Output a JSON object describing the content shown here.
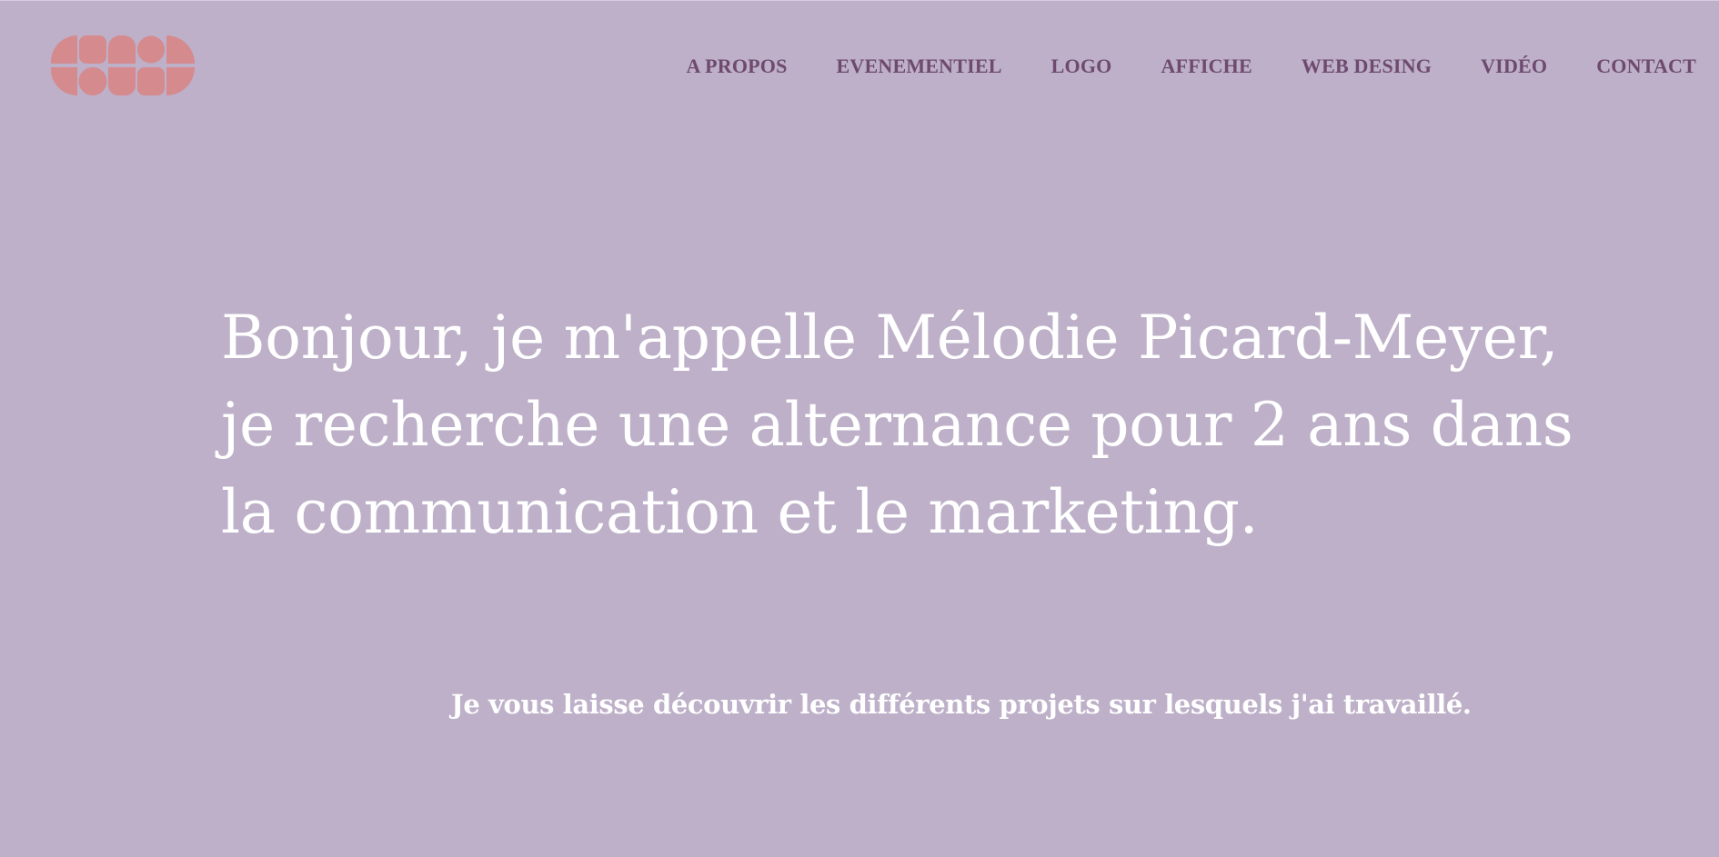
{
  "header": {
    "logo": "logo-mark-icon",
    "logo_color": "#d58a8e",
    "nav": [
      {
        "label": "A PROPOS"
      },
      {
        "label": "EVENEMENTIEL"
      },
      {
        "label": "LOGO"
      },
      {
        "label": "AFFICHE"
      },
      {
        "label": "WEB DESING"
      },
      {
        "label": "VIDÉO"
      },
      {
        "label": "CONTACT"
      }
    ]
  },
  "hero": {
    "lines": [
      "Bonjour, je m'appelle Mélodie Picard-Meyer,",
      "je recherche une alternance pour 2 ans dans",
      "la communication et le marketing."
    ]
  },
  "subtitle": "Je vous laisse découvrir les différents projets sur lesquels j'ai travaillé.",
  "colors": {
    "background": "#bdb0c8",
    "nav_text": "#6e4a6f",
    "hero_text": "#ffffff"
  }
}
